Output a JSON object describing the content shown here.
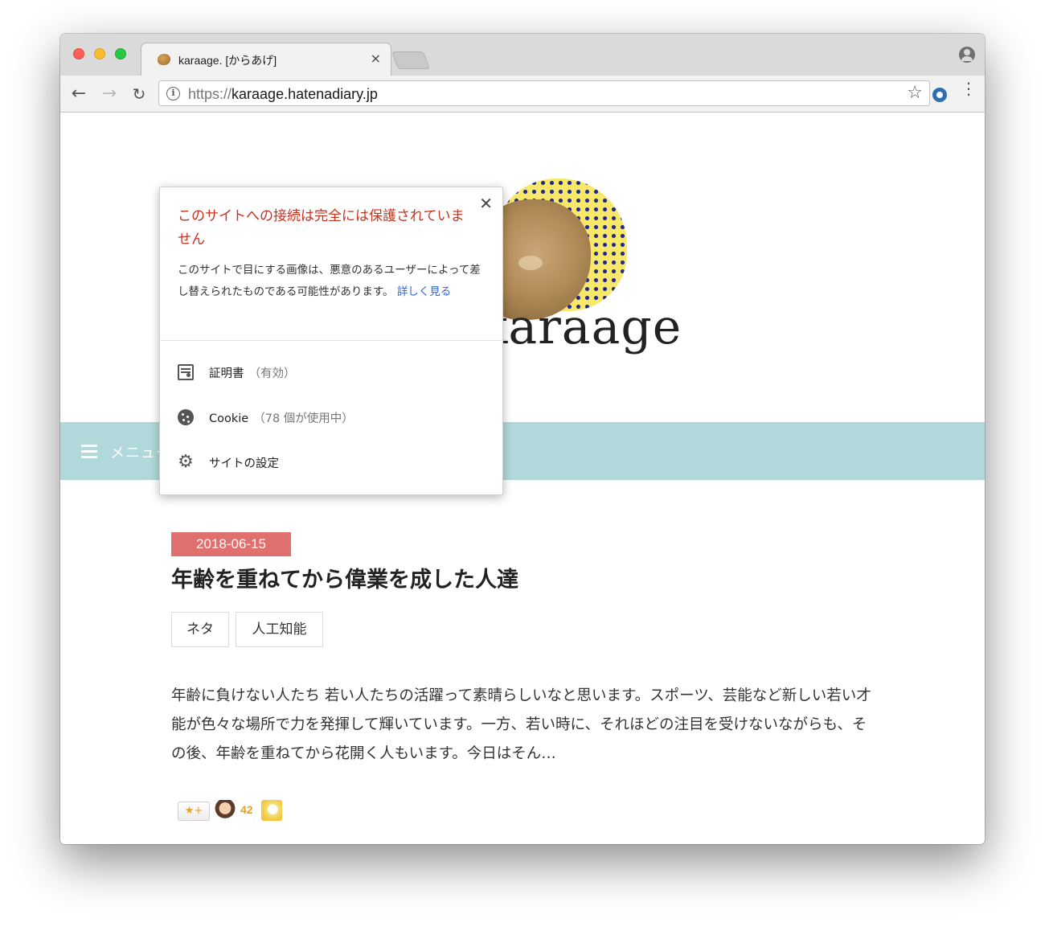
{
  "browser": {
    "tab_title": "karaage. [からあげ]",
    "tab_close": "×",
    "url_scheme": "https://",
    "url_host": "karaage.hatenadiary.jp",
    "back_glyph": "←",
    "forward_glyph": "→",
    "reload_glyph": "↻",
    "star_glyph": "☆",
    "info_glyph": "i",
    "menu_glyph": "⋮"
  },
  "site": {
    "logo_text": "karaage",
    "menu_label": "メニュー"
  },
  "popup": {
    "close_glyph": "✕",
    "heading": "このサイトへの接続は完全には保護されていません",
    "description": "このサイトで目にする画像は、悪意のあるユーザーによって差し替えられたものである可能性があります。",
    "learn_more": "詳しく見る",
    "rows": [
      {
        "label": "証明書",
        "sub": "（有効）",
        "icon": "certificate-icon"
      },
      {
        "label": "Cookie",
        "sub": "（78 個が使用中）",
        "icon": "cookie-icon"
      },
      {
        "label": "サイトの設定",
        "sub": "",
        "icon": "gear-icon"
      }
    ]
  },
  "article": {
    "date": "2018-06-15",
    "title": "年齢を重ねてから偉業を成した人達",
    "tags": [
      "ネタ",
      "人工知能"
    ],
    "excerpt": "年齢に負けない人たち 若い人たちの活躍って素晴らしいなと思います。スポーツ、芸能など新しい若い才能が色々な場所で力を発揮して輝いています。一方、若い時に、それほどの注目を受けないながらも、その後、年齢を重ねてから花開く人もいます。今日はそん…",
    "star_add_label": "★+",
    "star_count": "42"
  },
  "colors": {
    "menu_bar": "#b1d8da",
    "date_badge": "#e0706d",
    "warning_text": "#c5321e",
    "link": "#3367d6"
  }
}
